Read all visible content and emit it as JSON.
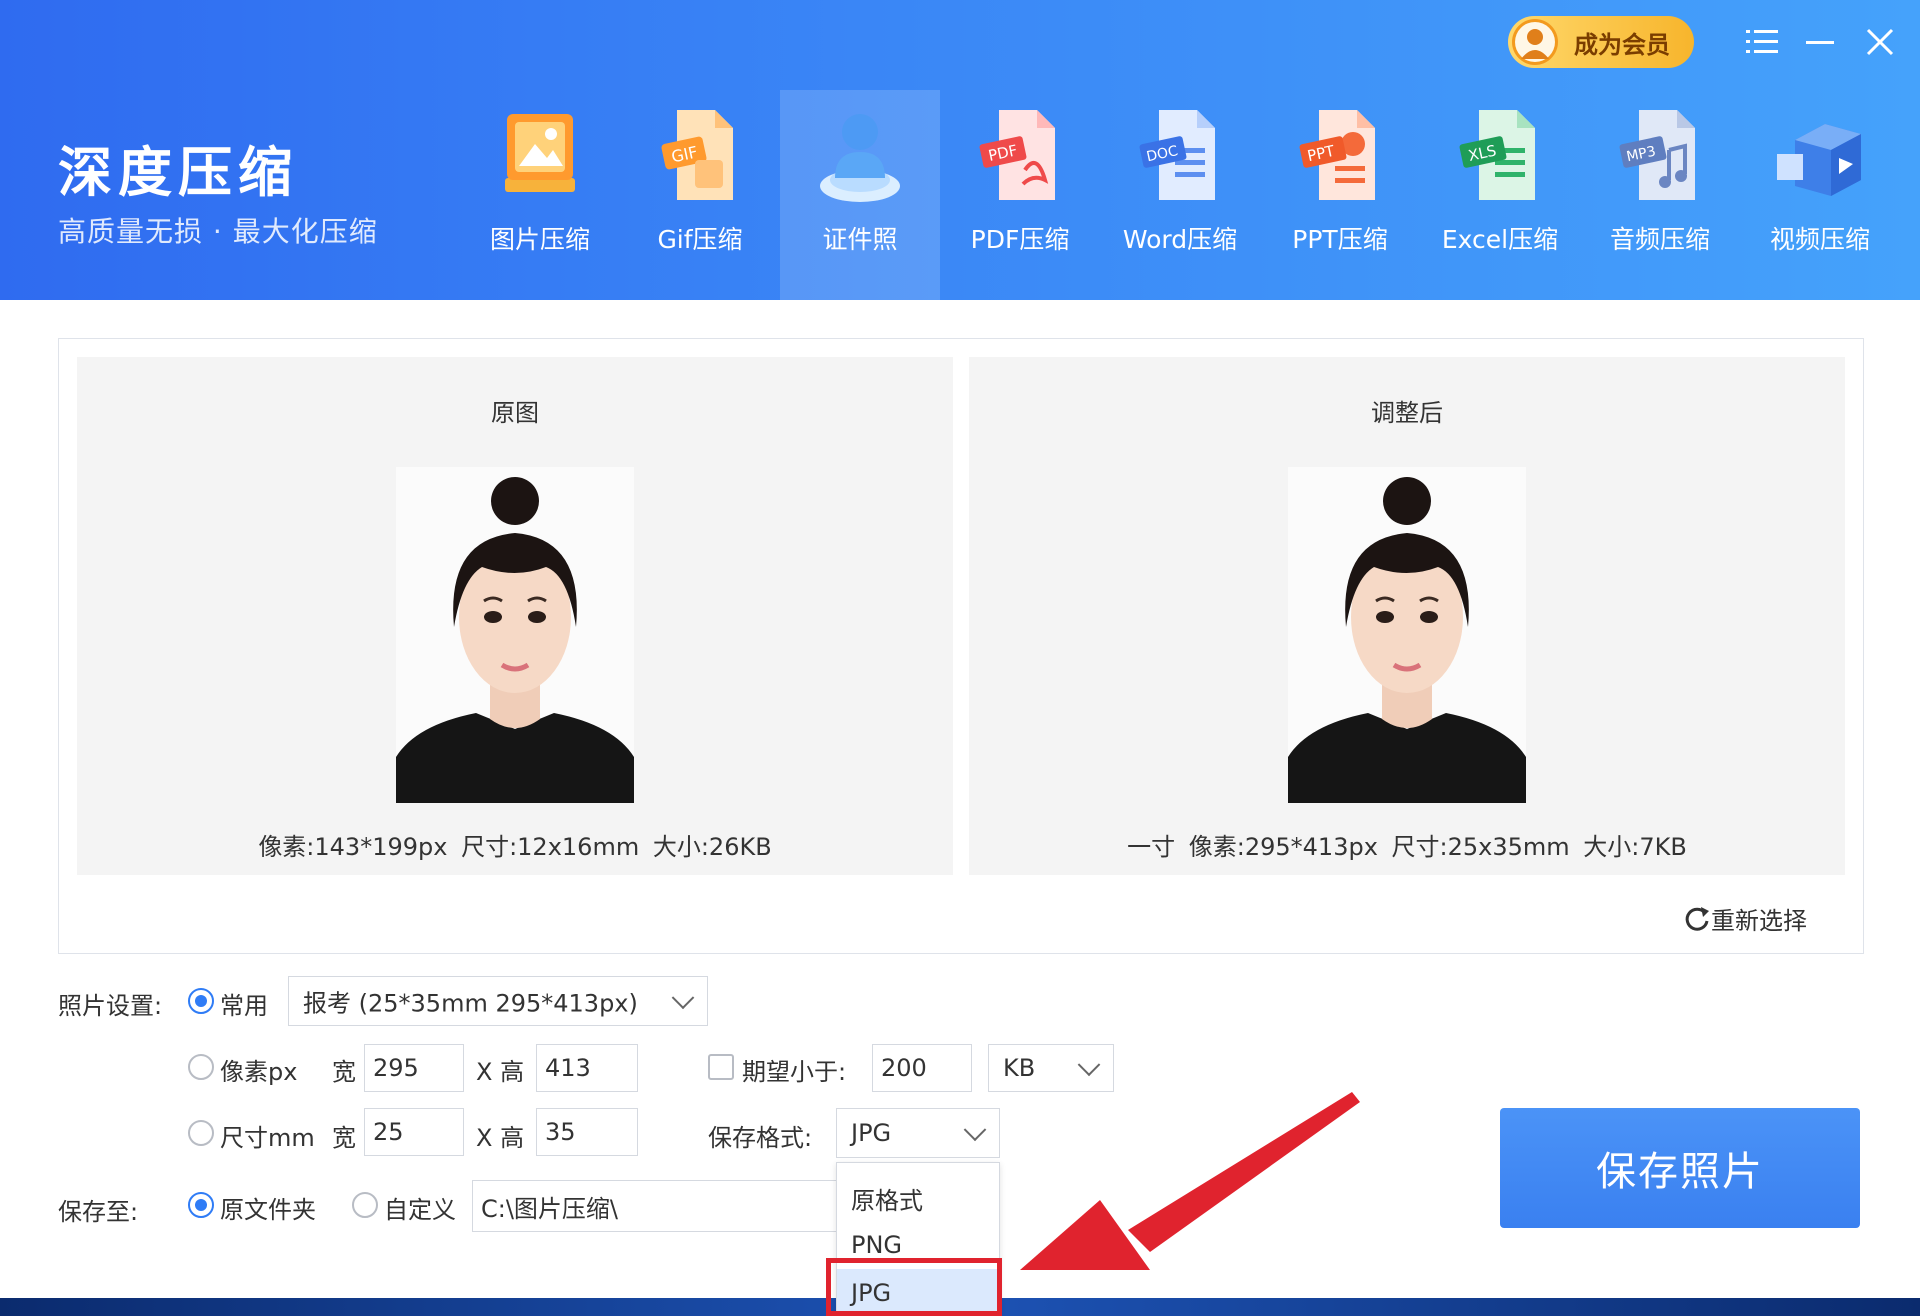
{
  "brand": {
    "title": "深度压缩",
    "subtitle": "高质量无损 · 最大化压缩"
  },
  "header": {
    "vip_label": "成为会员"
  },
  "nav": [
    {
      "label": "图片压缩",
      "icon": "image-icon"
    },
    {
      "label": "Gif压缩",
      "icon": "gif-icon"
    },
    {
      "label": "证件照",
      "icon": "id-photo-icon",
      "active": true
    },
    {
      "label": "PDF压缩",
      "icon": "pdf-icon"
    },
    {
      "label": "Word压缩",
      "icon": "word-icon"
    },
    {
      "label": "PPT压缩",
      "icon": "ppt-icon"
    },
    {
      "label": "Excel压缩",
      "icon": "excel-icon"
    },
    {
      "label": "音频压缩",
      "icon": "mp3-icon"
    },
    {
      "label": "视频压缩",
      "icon": "video-icon"
    }
  ],
  "preview": {
    "original": {
      "title": "原图",
      "info": "像素:143*199px  尺寸:12x16mm  大小:26KB"
    },
    "adjusted": {
      "title": "调整后",
      "info": "一寸  像素:295*413px  尺寸:25x35mm  大小:7KB"
    },
    "reselect_label": "重新选择"
  },
  "settings": {
    "photo_label": "照片设置:",
    "common_label": "常用",
    "common_value": "报考 (25*35mm 295*413px)",
    "pixel_label": "像素px",
    "mm_label": "尺寸mm",
    "width_label": "宽",
    "height_label": "X 高",
    "pixel_width": "295",
    "pixel_height": "413",
    "mm_width": "25",
    "mm_height": "35",
    "expect_label": "期望小于:",
    "expect_value": "200",
    "unit_value": "KB",
    "format_label": "保存格式:",
    "format_value": "JPG",
    "save_to_label": "保存至:",
    "original_folder_label": "原文件夹",
    "custom_label": "自定义",
    "path_value": "C:\\图片压缩\\"
  },
  "dropdown": {
    "options": [
      "原格式",
      "PNG",
      "JPG"
    ],
    "selected": "JPG"
  },
  "save_button_label": "保存照片",
  "colors": {
    "header_start": "#2f6bf0",
    "header_end": "#45a2fb",
    "accent": "#2f7cf6",
    "highlight": "#e0232e"
  }
}
